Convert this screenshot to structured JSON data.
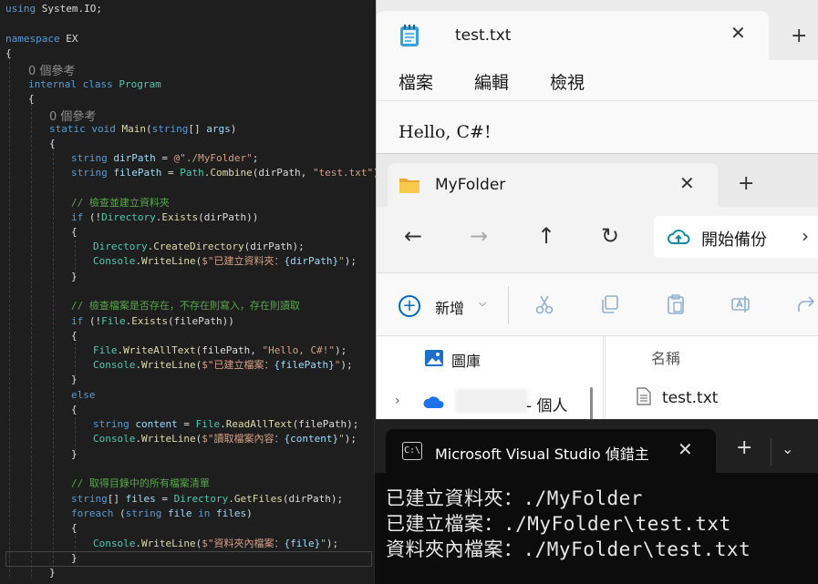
{
  "editor": {
    "codelens_1": "0 個參考",
    "codelens_2": "0 個參考",
    "lines": {
      "l1": [
        "using ",
        "System",
        ".",
        "IO",
        ";"
      ],
      "l2": [
        "namespace ",
        "EX"
      ],
      "l3": [
        "{"
      ],
      "l4": [
        "internal ",
        "class ",
        "Program"
      ],
      "l5": [
        "{"
      ],
      "l6": [
        "static ",
        "void ",
        "Main",
        "(",
        "string",
        "[] ",
        "args",
        ")"
      ],
      "l7": [
        "{"
      ],
      "l8": [
        "string ",
        "dirPath",
        " = ",
        "@\"./MyFolder\"",
        ";"
      ],
      "l9": [
        "string ",
        "filePath",
        " = ",
        "Path",
        ".",
        "Combine",
        "(dirPath, ",
        "\"test.txt\"",
        ");"
      ],
      "l10": [
        "// 檢查並建立資料夾"
      ],
      "l11": [
        "if ",
        "(!",
        "Directory",
        ".",
        "Exists",
        "(dirPath))"
      ],
      "l12": [
        "{"
      ],
      "l13": [
        "Directory",
        ".",
        "CreateDirectory",
        "(dirPath);"
      ],
      "l14": [
        "Console",
        ".",
        "WriteLine",
        "(",
        "$\"已建立資料夾：",
        "{dirPath}",
        "\"",
        ");"
      ],
      "l15": [
        "}"
      ],
      "l16": [
        "// 檢查檔案是否存在，不存在則寫入，存在則讀取"
      ],
      "l17": [
        "if ",
        "(!",
        "File",
        ".",
        "Exists",
        "(filePath))"
      ],
      "l18": [
        "{"
      ],
      "l19": [
        "File",
        ".",
        "WriteAllText",
        "(filePath, ",
        "\"Hello, C#!\"",
        ");"
      ],
      "l20": [
        "Console",
        ".",
        "WriteLine",
        "(",
        "$\"已建立檔案：",
        "{filePath}",
        "\"",
        ");"
      ],
      "l21": [
        "}"
      ],
      "l22": [
        "else"
      ],
      "l23": [
        "{"
      ],
      "l24": [
        "string ",
        "content",
        " = ",
        "File",
        ".",
        "ReadAllText",
        "(filePath);"
      ],
      "l25": [
        "Console",
        ".",
        "WriteLine",
        "(",
        "$\"讀取檔案內容：",
        "{content}",
        "\"",
        ");"
      ],
      "l26": [
        "}"
      ],
      "l27": [
        "// 取得目錄中的所有檔案清單"
      ],
      "l28": [
        "string",
        "[] ",
        "files",
        " = ",
        "Directory",
        ".",
        "GetFiles",
        "(dirPath);"
      ],
      "l29": [
        "foreach ",
        "(",
        "string ",
        "file ",
        "in ",
        "files",
        ")"
      ],
      "l30": [
        "{"
      ],
      "l31": [
        "Console",
        ".",
        "WriteLine",
        "(",
        "$\"資料夾內檔案：",
        "{file}",
        "\"",
        ");"
      ],
      "l32": [
        "}"
      ],
      "l33": [
        "}"
      ]
    }
  },
  "notepad": {
    "tab_title": "test.txt",
    "menu": [
      "檔案",
      "編輯",
      "檢視"
    ],
    "content": "Hello, C#!",
    "close_glyph": "✕",
    "newtab_glyph": "+"
  },
  "explorer": {
    "tab_title": "MyFolder",
    "close_glyph": "✕",
    "newtab_glyph": "+",
    "nav": {
      "back": "←",
      "forward": "→",
      "up": "↑",
      "refresh": "↻"
    },
    "backup_label": "開始備份",
    "backup_chevron": "›",
    "new_label": "新增",
    "new_chevron": "⌵",
    "icons": [
      "cut-icon",
      "copy-icon",
      "paste-icon",
      "rename-icon",
      "share-icon"
    ],
    "nav_pane": {
      "gallery": "圖庫",
      "onedrive_suffix": "- 個人",
      "expand": "›"
    },
    "column_name": "名稱",
    "file": "test.txt",
    "accent": "#0067c0"
  },
  "terminal": {
    "tab_title": "Microsoft Visual Studio 偵錯主",
    "icon_text": "C:\\",
    "close_glyph": "✕",
    "newtab_glyph": "+",
    "dropdown_glyph": "⌄",
    "output": [
      "已建立資料夾：./MyFolder",
      "已建立檔案：./MyFolder\\test.txt",
      "資料夾內檔案：./MyFolder\\test.txt"
    ]
  }
}
